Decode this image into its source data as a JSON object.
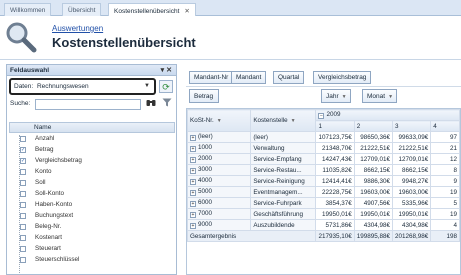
{
  "tabs": [
    {
      "label": "Willkommen"
    },
    {
      "label": "Übersicht"
    },
    {
      "label": "Kostenstellenübersicht",
      "close": "✕"
    }
  ],
  "header": {
    "breadcrumb": "Auswertungen",
    "title": "Kostenstellenübersicht"
  },
  "field_panel": {
    "title": "Feldauswahl",
    "controls": "▾ ✕",
    "daten_label": "Daten:",
    "daten_value": "Rechnungswesen",
    "search_label": "Suche:",
    "list_header": "Name",
    "items": [
      {
        "label": "Anzahl",
        "checked": false
      },
      {
        "label": "Betrag",
        "checked": true
      },
      {
        "label": "Vergleichsbetrag",
        "checked": true
      },
      {
        "label": "Konto",
        "checked": false
      },
      {
        "label": "Soll",
        "checked": false
      },
      {
        "label": "Soll-Konto",
        "checked": false
      },
      {
        "label": "Haben-Konto",
        "checked": false
      },
      {
        "label": "Buchungstext",
        "checked": false
      },
      {
        "label": "Beleg-Nr.",
        "checked": false
      },
      {
        "label": "Kostenart",
        "checked": false
      },
      {
        "label": "Steuerart",
        "checked": false
      },
      {
        "label": "Steuerschlüssel",
        "checked": false
      }
    ]
  },
  "pivot": {
    "filter_fields": [
      "Mandant-Nr",
      "Mandant",
      "Quartal",
      "Vergleichsbetrag"
    ],
    "data_field": "Betrag",
    "column_fields": [
      {
        "label": "Jahr"
      },
      {
        "label": "Monat"
      }
    ],
    "row_fields": [
      {
        "label": "KoSt-Nr."
      },
      {
        "label": "Kostenstelle"
      }
    ],
    "year": "2009",
    "months": [
      "1",
      "2",
      "3",
      "4"
    ],
    "rows": [
      {
        "nr": "(leer)",
        "name": "(leer)",
        "values": [
          "107123,75€",
          "98650,36€",
          "99633,09€",
          "97"
        ]
      },
      {
        "nr": "1000",
        "name": "Verwaltung",
        "values": [
          "21348,70€",
          "21222,51€",
          "21222,51€",
          "21"
        ]
      },
      {
        "nr": "2000",
        "name": "Service-Empfang",
        "values": [
          "14247,43€",
          "12709,01€",
          "12709,01€",
          "12"
        ]
      },
      {
        "nr": "3000",
        "name": "Service-Restau...",
        "values": [
          "11035,82€",
          "8662,15€",
          "8662,15€",
          "8"
        ]
      },
      {
        "nr": "4000",
        "name": "Service-Reinigung",
        "values": [
          "12414,41€",
          "9886,30€",
          "9948,27€",
          "9"
        ]
      },
      {
        "nr": "5000",
        "name": "Eventmanagem...",
        "values": [
          "22228,75€",
          "19603,00€",
          "19603,00€",
          "19"
        ]
      },
      {
        "nr": "6000",
        "name": "Service-Fuhrpark",
        "values": [
          "3854,37€",
          "4907,56€",
          "5335,96€",
          "5"
        ]
      },
      {
        "nr": "7000",
        "name": "Geschäftsführung",
        "values": [
          "19950,01€",
          "19950,01€",
          "19950,01€",
          "19"
        ]
      },
      {
        "nr": "9000",
        "name": "Auszubildende",
        "values": [
          "5731,86€",
          "4304,98€",
          "4304,98€",
          "4"
        ]
      }
    ],
    "total_label": "Gesamtergebnis",
    "totals": [
      "217935,10€",
      "199895,88€",
      "201268,98€",
      "198"
    ]
  }
}
